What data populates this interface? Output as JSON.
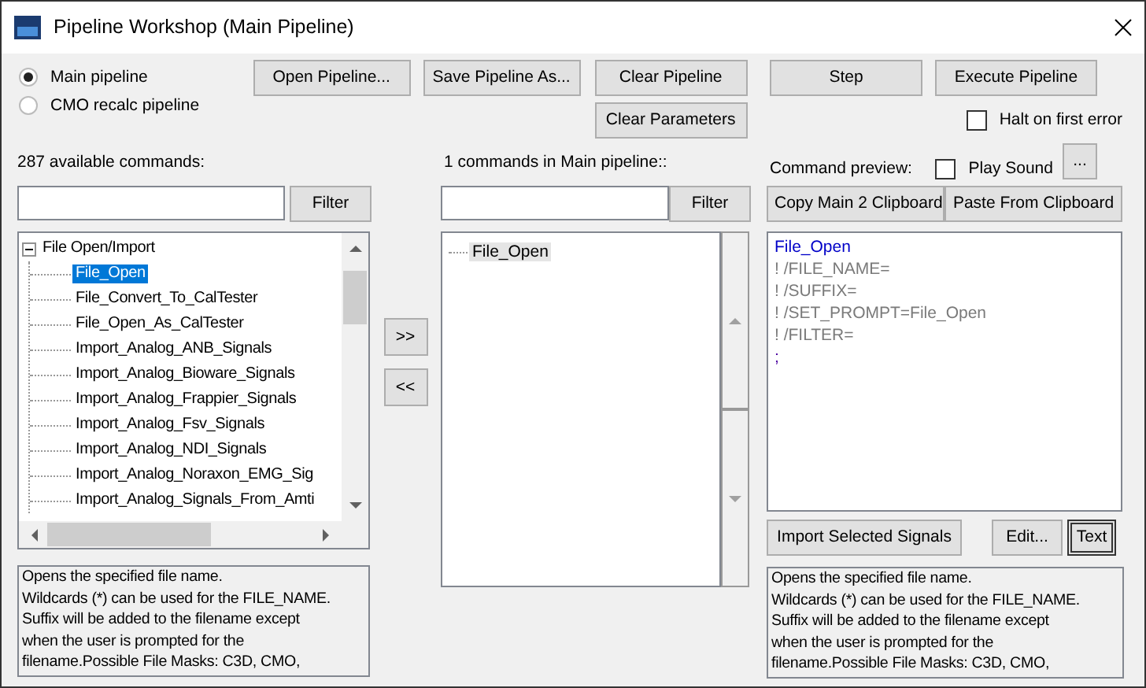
{
  "window": {
    "title": "Pipeline Workshop (Main Pipeline)"
  },
  "pipeline_options": [
    {
      "label": "Main pipeline",
      "selected": true
    },
    {
      "label": "CMO recalc pipeline",
      "selected": false
    }
  ],
  "toolbar_buttons": [
    "Open Pipeline...",
    "Save Pipeline As...",
    "Clear Pipeline",
    "Clear Parameters"
  ],
  "run_buttons": [
    "Step",
    "Execute Pipeline"
  ],
  "options": [
    {
      "label": "Halt on first error",
      "checked": false
    },
    {
      "label": "Play Sound",
      "checked": false
    }
  ],
  "sound_button": "...",
  "available": {
    "label": "287 available commands:",
    "filter_button": "Filter",
    "tree": [
      {
        "label": "File Open/Import",
        "expanded": true,
        "selected": false,
        "children": [
          {
            "label": "File_Open",
            "selected": true
          },
          {
            "label": "File_Convert_To_CalTester",
            "selected": false
          },
          {
            "label": "File_Open_As_CalTester",
            "selected": false
          },
          {
            "label": "Import_Analog_ANB_Signals",
            "selected": false
          },
          {
            "label": "Import_Analog_Bioware_Signals",
            "selected": false
          },
          {
            "label": "Import_Analog_Frappier_Signals",
            "selected": false
          },
          {
            "label": "Import_Analog_Fsv_Signals",
            "selected": false
          },
          {
            "label": "Import_Analog_NDI_Signals",
            "selected": false
          },
          {
            "label": "Import_Analog_Noraxon_EMG_Sig",
            "selected": false
          },
          {
            "label": "Import_Analog_Signals_From_Amti",
            "selected": false
          }
        ]
      }
    ],
    "description": [
      "Opens the specified file name.",
      "Wildcards (*) can be used for the FILE_NAME.",
      "Suffix will be added to the filename except",
      "when the user is prompted for the",
      "filename.Possible File Masks: C3D, CMO,"
    ]
  },
  "transfer_buttons": [
    ">>",
    "<<"
  ],
  "pipeline": {
    "label": "1 commands in Main pipeline::",
    "filter_button": "Filter",
    "items": [
      {
        "label": "File_Open",
        "selected": true
      }
    ]
  },
  "preview": {
    "label": "Command preview:",
    "buttons": [
      "Copy Main 2 Clipboard",
      "Paste From Clipboard"
    ],
    "lines": [
      {
        "text": "File_Open",
        "kind": "command"
      },
      {
        "text": "! /FILE_NAME=",
        "kind": "parameter"
      },
      {
        "text": "! /SUFFIX=",
        "kind": "parameter"
      },
      {
        "text": "! /SET_PROMPT=File_Open",
        "kind": "parameter"
      },
      {
        "text": "! /FILTER=",
        "kind": "parameter"
      },
      {
        "text": ";",
        "kind": "terminator"
      }
    ],
    "actions": [
      {
        "label": "Import Selected Signals",
        "focused": false
      },
      {
        "label": "Edit...",
        "focused": false
      },
      {
        "label": "Text",
        "focused": true
      }
    ],
    "description": [
      "Opens the specified file name.",
      "Wildcards (*) can be used for the FILE_NAME.",
      "Suffix will be added to the filename except",
      "when the user is prompted for the",
      "filename.Possible File Masks: C3D, CMO,"
    ]
  }
}
